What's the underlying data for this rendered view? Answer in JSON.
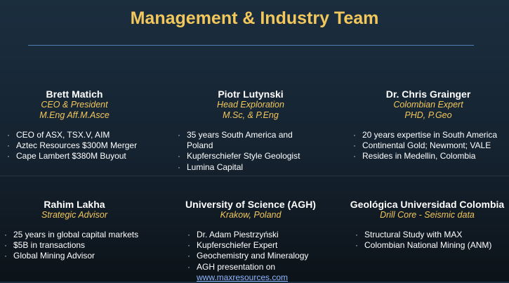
{
  "title": "Management & Industry Team",
  "team": [
    {
      "name": "Brett Matich",
      "roles": [
        "CEO & President",
        "M.Eng Aff.M.Asce"
      ],
      "bullets": [
        "CEO of ASX, TSX.V, AIM",
        "Aztec Resources $300M Merger",
        "Cape Lambert $380M Buyout"
      ]
    },
    {
      "name": "Piotr Lutynski",
      "roles": [
        "Head Exploration",
        "M.Sc, & P.Eng"
      ],
      "bullets": [
        "35 years South America and Poland",
        "Kupferschiefer Style Geologist",
        "Lumina Capital"
      ]
    },
    {
      "name": "Dr. Chris Grainger",
      "roles": [
        "Colombian Expert",
        "PHD, P.Geo"
      ],
      "bullets": [
        "20 years expertise in South America",
        "Continental Gold; Newmont; VALE",
        "Resides in Medellin, Colombia"
      ]
    },
    {
      "name": "Rahim Lakha",
      "roles": [
        "Strategic Advisor"
      ],
      "bullets": [
        "25 years in global capital markets",
        "$5B in transactions",
        "Global Mining Advisor"
      ]
    },
    {
      "name": "University of Science (AGH)",
      "roles": [
        "Krakow, Poland"
      ],
      "bullets": [
        "Dr. Adam Piestrzyński",
        "Kupferschiefer Expert",
        "Geochemistry and Mineralogy",
        "AGH presentation on"
      ],
      "link": "www.maxresources.com"
    },
    {
      "name": "Geológica Universidad Colombia",
      "roles": [
        "Drill Core - Seismic data"
      ],
      "bullets": [
        "Structural Study with MAX",
        "Colombian National Mining (ANM)"
      ]
    }
  ]
}
